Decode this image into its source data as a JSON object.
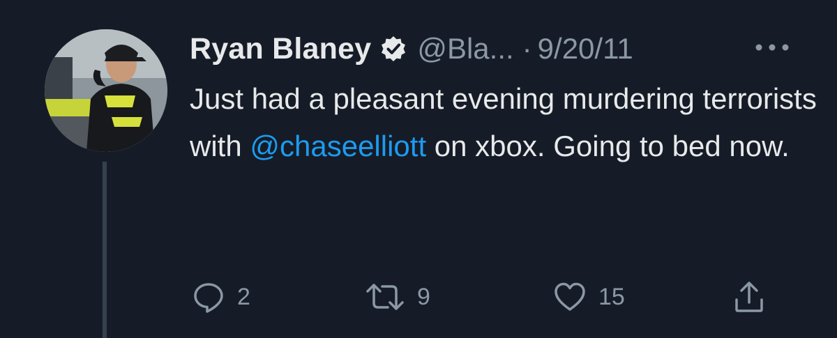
{
  "user": {
    "name": "Ryan Blaney",
    "handle": "@Bla...",
    "separator": "·",
    "date": "9/20/11"
  },
  "tweet": {
    "text_part1": "Just had a pleasant evening murdering terrorists with ",
    "mention": "@chaseelliott",
    "text_part2": " on xbox. Going to bed now."
  },
  "actions": {
    "reply_count": "2",
    "retweet_count": "9",
    "like_count": "15"
  },
  "icons": {
    "verified": "verified-badge-icon",
    "more": "more-options-icon",
    "reply": "reply-icon",
    "retweet": "retweet-icon",
    "like": "like-icon",
    "share": "share-icon"
  },
  "colors": {
    "background": "#161c27",
    "mention": "#1d9bf0",
    "secondary_text": "#8b98a5"
  }
}
